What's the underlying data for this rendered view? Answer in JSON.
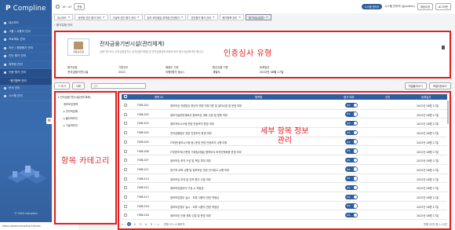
{
  "app": {
    "logo": "Compline"
  },
  "sidebar": {
    "items": [
      {
        "label": "대시보드"
      },
      {
        "label": "그룹 / 사용자 관리"
      },
      {
        "label": "프로젝트 관리"
      },
      {
        "label": "자산 / 위험평가 관리"
      },
      {
        "label": "진단 평가 관리"
      },
      {
        "label": "취약점 관리"
      },
      {
        "label": "인증 평가 관리"
      }
    ],
    "sub_item": "· 평가항목 관리",
    "items_after": [
      {
        "label": "문서 관리"
      },
      {
        "label": "시스템 관리"
      }
    ],
    "copyright": "© 2023 Compline",
    "url": "https://www.compline.kr/isms"
  },
  "topbar": {
    "time": "19 : 47",
    "extend": "연장",
    "badge": "시스템 관리자",
    "user": "시스템 관리자 님(admin)",
    "profile_btn": "계정수정",
    "logout_btn": "로그아웃"
  },
  "tabs": [
    {
      "label": "대시보드"
    },
    {
      "label": "공관정 진단 평가 관리"
    },
    {
      "label": "기술적 진단 평가 관리"
    },
    {
      "label": "정기 보안점검 취약점 진단평가"
    },
    {
      "label": "진단평가 평가 관리"
    },
    {
      "label": "평가항목 관리"
    },
    {
      "label": "평가대상(분류)"
    }
  ],
  "breadcrumb": "평가유형 관리",
  "org": {
    "logo_text": "금융보안원",
    "title": "전자금융기반시설(관리체계)",
    "description": "금융기관 또는 전자금융업자는 전자금융거래법 및 전자금융감독규정에 따라 매년 점검하여야 합니다",
    "cert_type": "인증심사 유형",
    "meta": [
      {
        "label": "평가유형",
        "value": "전자금융기반시설"
      },
      {
        "label": "기준년도",
        "value": "2021"
      },
      {
        "label": "배점도 기준",
        "value": "이행(평가 점수)"
      },
      {
        "label": "합산산출 기준",
        "value": "계열도"
      },
      {
        "label": "등록일자",
        "value": "2022년 08월 17일"
      }
    ]
  },
  "toolbar": {
    "add": "+ 추가",
    "delete": "삭제",
    "search_placeholder": "검색",
    "excel_in": "엑셀불러오기",
    "excel_out": "엑셀다운로드"
  },
  "categories": {
    "items": [
      "전자금융기반시설(관리체계)",
      "정보보호정책",
      "전자적침해",
      "물리적보안",
      "기술적보안"
    ],
    "label": "항목 카테고리"
  },
  "table": {
    "headers": [
      "항목 ID",
      "항목명",
      "평가 여부",
      "순번",
      "등록일자"
    ],
    "rows": [
      {
        "id": "FI0B-001",
        "name": "정보보호 관련법규 최신의 변경 여부기준 및 절차수립 및 운영 여부",
        "toggle": "ON",
        "date": "2022년 08월 17일"
      },
      {
        "id": "FI0B-002",
        "name": "정보기술부문계획서 정보보호 계획 수립 및 운용 여부",
        "toggle": "ON",
        "date": "2022년 08월 17일"
      },
      {
        "id": "FI0B-003",
        "name": "정보처리시스템 관련 안정조치 운영 여부",
        "toggle": "ON",
        "date": "2022년 08월 17일"
      },
      {
        "id": "FI0B-004",
        "name": "전자금융업무 관련 안전조치 운영 여부",
        "toggle": "ON",
        "date": "2022년 08월 17일"
      },
      {
        "id": "FI0B-005",
        "name": "IT부문(정보시스템 등) 운영 관련 안정조치 시행 여부",
        "toggle": "ON",
        "date": "2022년 08월 17일"
      },
      {
        "id": "FI0B-006",
        "name": "IT부문조직(IT운영 기획팀/개발) 협력부서 조직인력확충 운영 여부",
        "toggle": "ON",
        "date": "2022년 08월 17일"
      },
      {
        "id": "FI0B-007",
        "name": "정보보호 조직 구성 및 책임 부여 여부",
        "toggle": "ON",
        "date": "2022년 08월 17일"
      },
      {
        "id": "FI0B-011",
        "name": "정기적 교육 시행 및 정보보호 관련 인식제고 시행 여부",
        "toggle": "ON",
        "date": "2022년 08월 17일"
      },
      {
        "id": "FI0B-014",
        "name": "정보보호 조직 및 인력 평가 수립 여부",
        "toggle": "ON",
        "date": "2022년 08월 17일"
      },
      {
        "id": "FI0B-012",
        "name": "정보보호업무의 구성 시 적정성",
        "toggle": "ON",
        "date": "2022년 08월 17일"
      },
      {
        "id": "FI0B-013",
        "name": "정보보호업무 실시 - 외부 사용자 관련 적정성",
        "toggle": "ON",
        "date": "2022년 08월 17일"
      },
      {
        "id": "FI0B-018",
        "name": "정보보호업무 실시 - 외부 사용자 관련 적정성",
        "toggle": "ON",
        "date": "2022년 08월 17일"
      },
      {
        "id": "FI0B-016",
        "name": "정보보호 인증 계획 수립 및 운영 여부",
        "toggle": "ON",
        "date": "2022년 08월 17일"
      }
    ],
    "detail_label_1": "세부 항목 정보",
    "detail_label_2": "관리",
    "pager_pages": [
      "1",
      "2",
      "3",
      "4",
      "5"
    ],
    "pager_current": "1",
    "pager_info": "전체 13 / 4 페이지",
    "pager_total": "전체 23건 중 1-13건"
  }
}
